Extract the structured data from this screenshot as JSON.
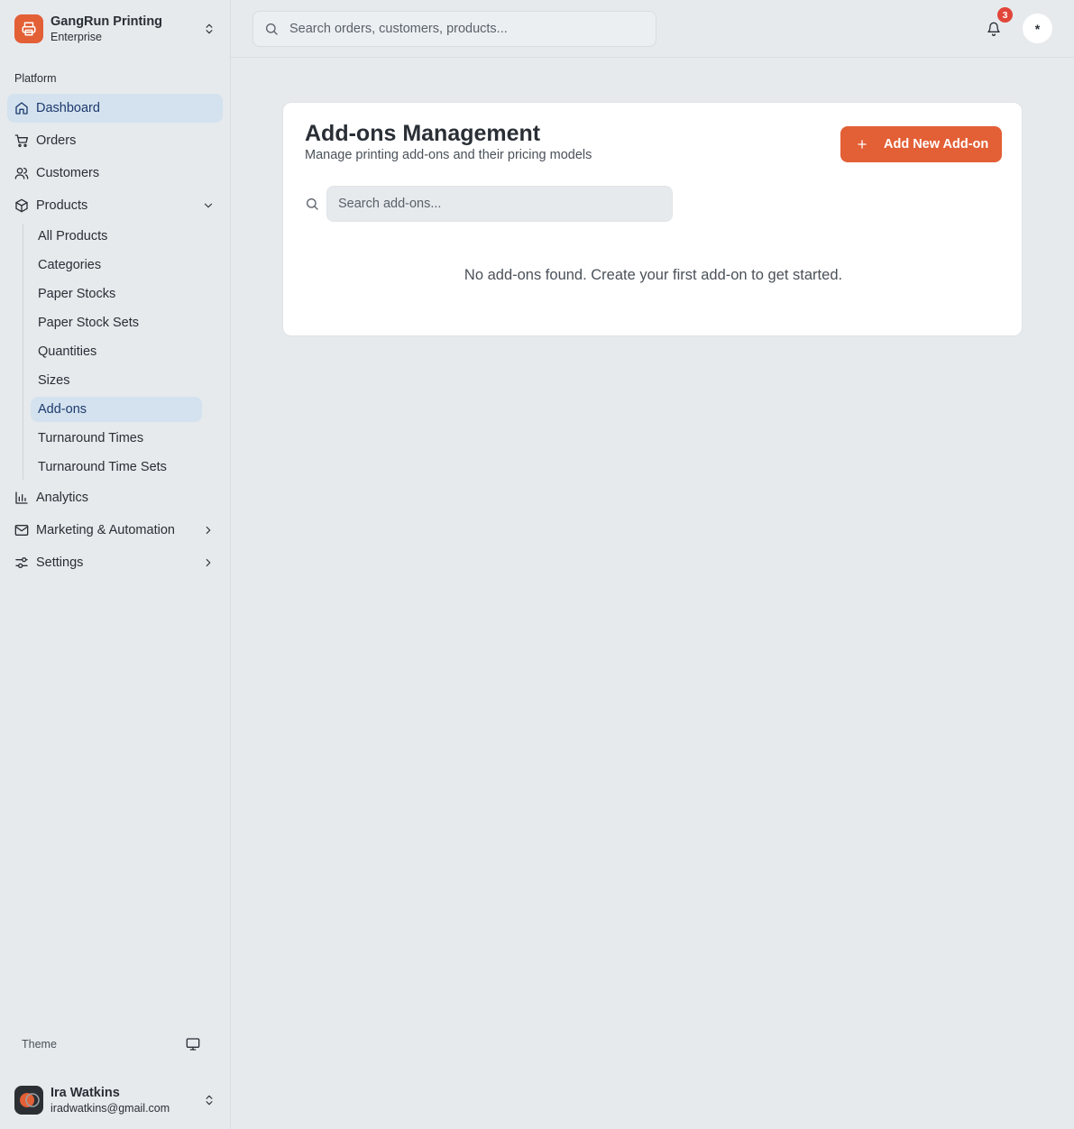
{
  "brand": {
    "name": "GangRun Printing",
    "plan": "Enterprise",
    "accent": "#e35f36"
  },
  "sidebar": {
    "section": "Platform",
    "items": [
      {
        "label": "Dashboard",
        "icon": "home-icon"
      },
      {
        "label": "Orders",
        "icon": "cart-icon"
      },
      {
        "label": "Customers",
        "icon": "users-icon"
      },
      {
        "label": "Products",
        "icon": "package-icon"
      },
      {
        "label": "Analytics",
        "icon": "bar-chart-icon"
      },
      {
        "label": "Marketing & Automation",
        "icon": "mail-icon"
      },
      {
        "label": "Settings",
        "icon": "sliders-icon"
      }
    ],
    "products_sub": [
      "All Products",
      "Categories",
      "Paper Stocks",
      "Paper Stock Sets",
      "Quantities",
      "Sizes",
      "Add-ons",
      "Turnaround Times",
      "Turnaround Time Sets"
    ],
    "theme_label": "Theme"
  },
  "user": {
    "name": "Ira Watkins",
    "email": "iradwatkins@gmail.com"
  },
  "topbar": {
    "search_placeholder": "Search orders, customers, products...",
    "notification_count": "3",
    "profile_initial": "*"
  },
  "main": {
    "title": "Add-ons Management",
    "subtitle": "Manage printing add-ons and their pricing models",
    "add_button": "Add New Add-on",
    "search_placeholder": "Search add-ons...",
    "empty_message": "No add-ons found. Create your first add-on to get started."
  }
}
